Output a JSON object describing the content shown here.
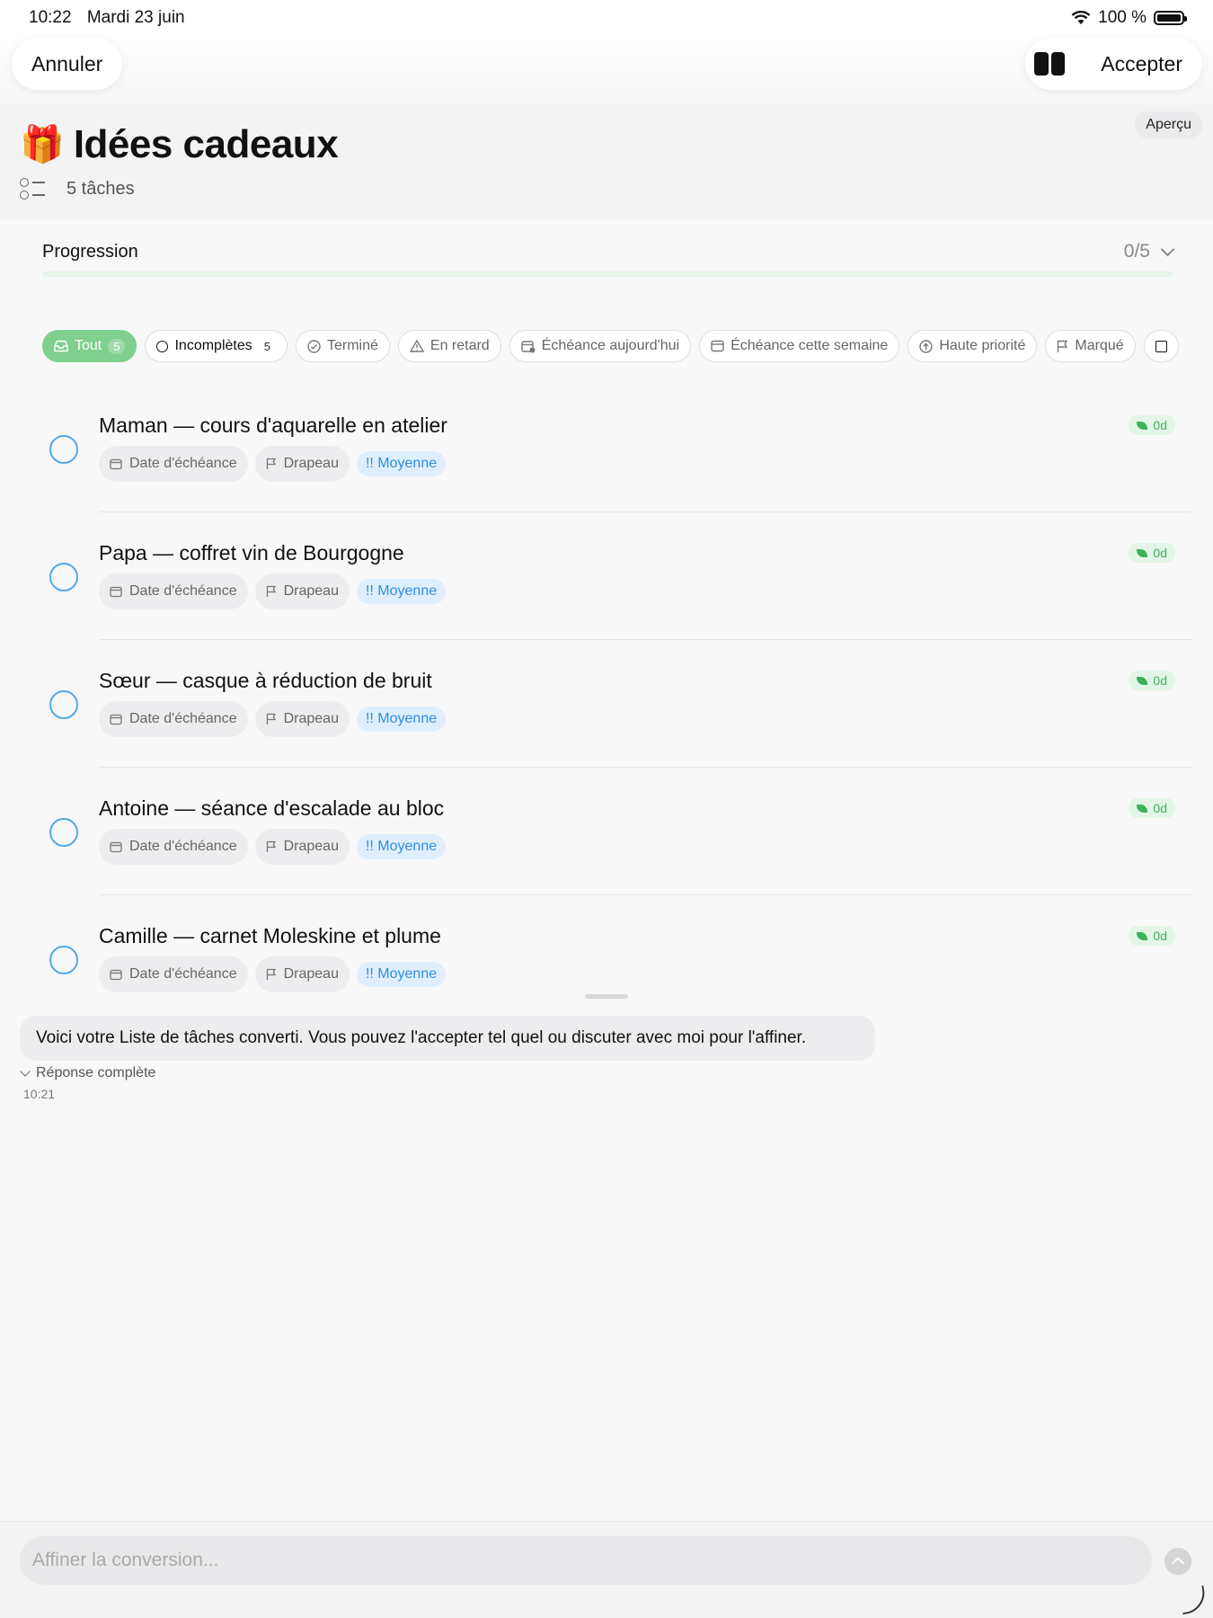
{
  "statusbar": {
    "time": "10:22",
    "date": "Mardi 23 juin",
    "battery": "100 %"
  },
  "topbar": {
    "cancel": "Annuler",
    "accept": "Accepter"
  },
  "header": {
    "preview": "Aperçu",
    "emoji": "🎁",
    "title": "Idées cadeaux",
    "count": "5 tâches"
  },
  "progress": {
    "label": "Progression",
    "value": "0/5",
    "fraction": 0
  },
  "filters": [
    {
      "label": "Tout",
      "badge": "5",
      "active": true,
      "icon": "tray-icon"
    },
    {
      "label": "Incomplètes",
      "badge": "5",
      "icon": "circle-icon"
    },
    {
      "label": "Terminé",
      "icon": "check-circle-icon"
    },
    {
      "label": "En retard",
      "icon": "warning-icon"
    },
    {
      "label": "Échéance aujourd'hui",
      "icon": "calendar-clock-icon"
    },
    {
      "label": "Échéance cette semaine",
      "icon": "calendar-icon"
    },
    {
      "label": "Haute priorité",
      "icon": "arrow-up-circle-icon"
    },
    {
      "label": "Marqué",
      "icon": "flag-icon"
    }
  ],
  "tasks": [
    {
      "title": "Maman — cours d'aquarelle en atelier",
      "due": "Date d'échéance",
      "flag": "Drapeau",
      "priority": "!! Moyenne",
      "badge": "0d"
    },
    {
      "title": "Papa — coffret vin de Bourgogne",
      "due": "Date d'échéance",
      "flag": "Drapeau",
      "priority": "!! Moyenne",
      "badge": "0d"
    },
    {
      "title": "Sœur — casque à réduction de bruit",
      "due": "Date d'échéance",
      "flag": "Drapeau",
      "priority": "!! Moyenne",
      "badge": "0d"
    },
    {
      "title": "Antoine — séance d'escalade au bloc",
      "due": "Date d'échéance",
      "flag": "Drapeau",
      "priority": "!! Moyenne",
      "badge": "0d"
    },
    {
      "title": "Camille — carnet Moleskine et plume",
      "due": "Date d'échéance",
      "flag": "Drapeau",
      "priority": "!! Moyenne",
      "badge": "0d"
    }
  ],
  "chat": {
    "message": "Voici votre Liste de tâches converti. Vous pouvez l'accepter tel quel ou discuter avec moi pour l'affiner.",
    "status": "Réponse complète",
    "time": "10:21"
  },
  "composer": {
    "placeholder": "Affiner la conversion..."
  }
}
